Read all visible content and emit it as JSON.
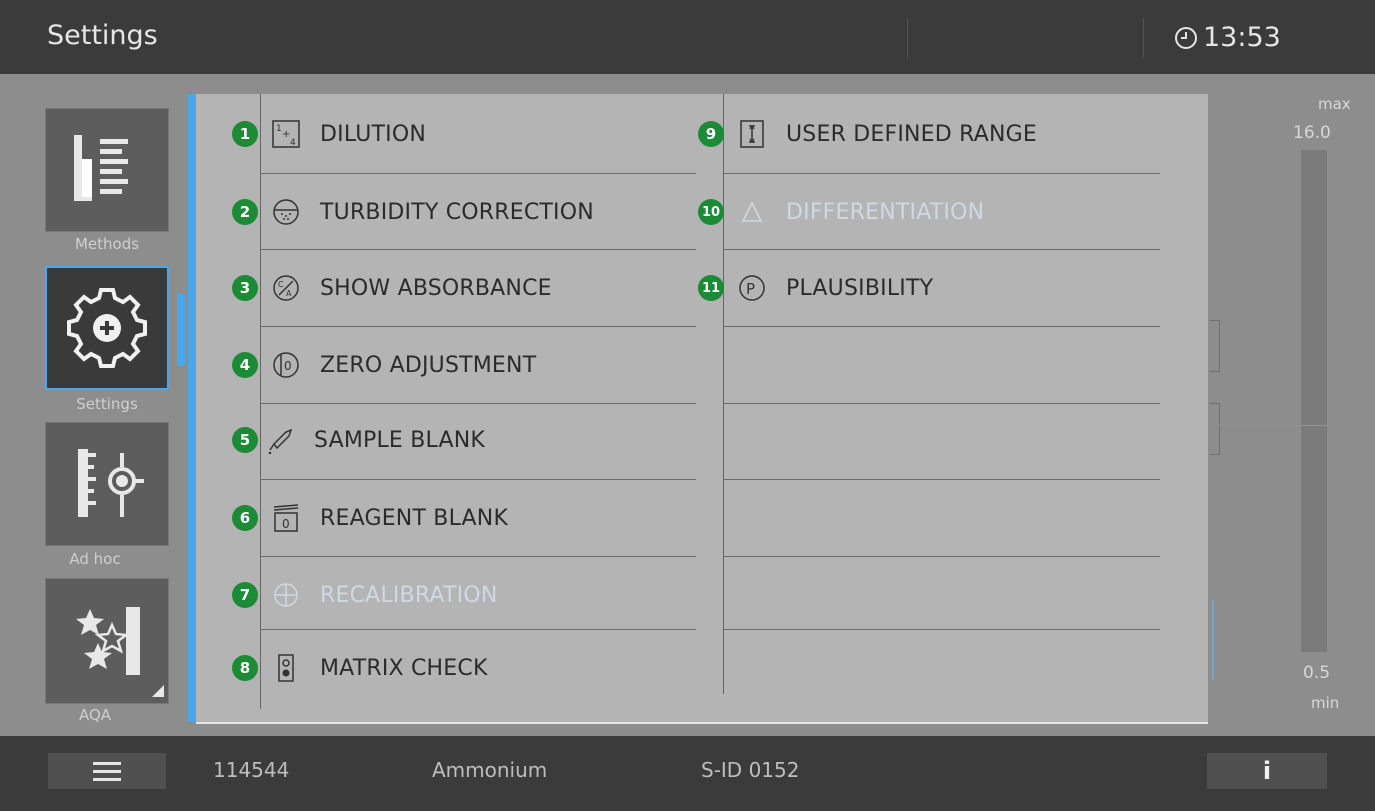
{
  "header": {
    "title": "Settings",
    "time": "13:53",
    "clock_icon": "clock-icon"
  },
  "nav": [
    {
      "label": "Methods",
      "icon": "methods-icon"
    },
    {
      "label": "Settings",
      "icon": "gear-icon",
      "selected": true
    },
    {
      "label": "Ad hoc",
      "icon": "adhoc-icon"
    },
    {
      "label": "AQA",
      "icon": "aqa-icon"
    }
  ],
  "menu_left": [
    {
      "num": "1",
      "label": "DILUTION",
      "icon": "dilution-icon",
      "enabled": true
    },
    {
      "num": "2",
      "label": "TURBIDITY CORRECTION",
      "icon": "turbidity-icon",
      "enabled": true
    },
    {
      "num": "3",
      "label": "SHOW ABSORBANCE",
      "icon": "absorbance-icon",
      "enabled": true
    },
    {
      "num": "4",
      "label": "ZERO ADJUSTMENT",
      "icon": "zero-adjustment-icon",
      "enabled": true
    },
    {
      "num": "5",
      "label": "SAMPLE BLANK",
      "icon": "pipette-icon",
      "enabled": true
    },
    {
      "num": "6",
      "label": "REAGENT BLANK",
      "icon": "reagent-blank-icon",
      "enabled": true
    },
    {
      "num": "7",
      "label": "RECALIBRATION",
      "icon": "recalibration-icon",
      "enabled": false
    },
    {
      "num": "8",
      "label": "MATRIX CHECK",
      "icon": "matrix-check-icon",
      "enabled": true
    }
  ],
  "menu_right": [
    {
      "num": "9",
      "label": "USER DEFINED RANGE",
      "icon": "range-icon",
      "enabled": true
    },
    {
      "num": "10",
      "label": "DIFFERENTIATION",
      "icon": "delta-icon",
      "enabled": false
    },
    {
      "num": "11",
      "label": "PLAUSIBILITY",
      "icon": "plausibility-icon",
      "enabled": true
    }
  ],
  "scale": {
    "max_label": "max",
    "max_value": "16.0",
    "min_value": "0.5",
    "min_label": "min"
  },
  "footer": {
    "menu_icon": "hamburger-icon",
    "method_number": "114544",
    "method_name": "Ammonium",
    "sample_id": "S-ID 0152",
    "info_label": "i"
  },
  "colors": {
    "accent": "#4aa7e8",
    "badge": "#1d8a36",
    "panel": "#b4b4b4"
  }
}
